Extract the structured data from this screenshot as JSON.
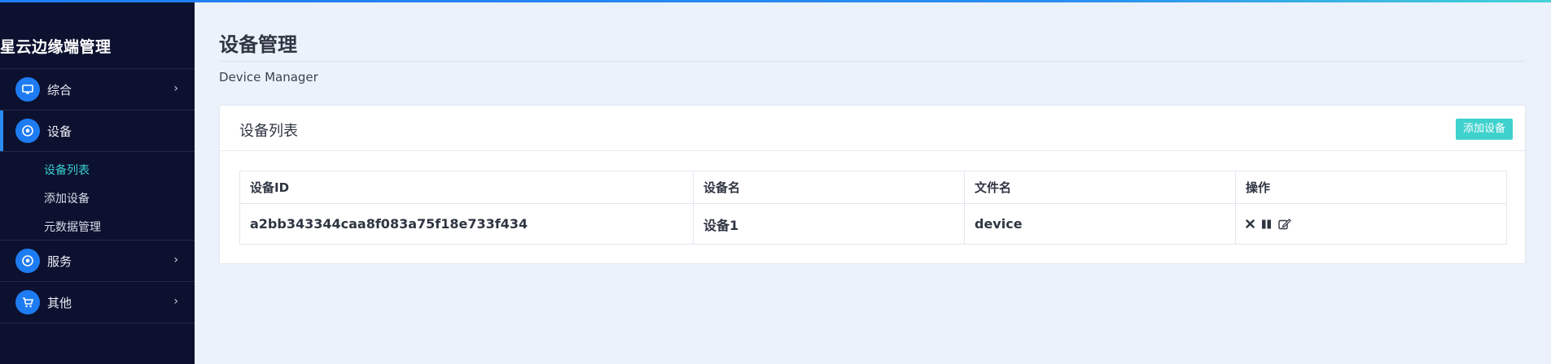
{
  "app": {
    "brand": "星云边缘端管理"
  },
  "sidebar": {
    "items": [
      {
        "label": "综合",
        "icon": "monitor-icon",
        "expanded": false
      },
      {
        "label": "设备",
        "icon": "soccer-icon",
        "expanded": true,
        "children": [
          {
            "label": "设备列表",
            "active": true
          },
          {
            "label": "添加设备",
            "active": false
          },
          {
            "label": "元数据管理",
            "active": false
          }
        ]
      },
      {
        "label": "服务",
        "icon": "soccer-icon",
        "expanded": false
      },
      {
        "label": "其他",
        "icon": "cart-icon",
        "expanded": false
      }
    ]
  },
  "page": {
    "title": "设备管理",
    "subtitle": "Device Manager"
  },
  "card": {
    "title": "设备列表",
    "add_button": "添加设备"
  },
  "table": {
    "headers": [
      "设备ID",
      "设备名",
      "文件名",
      "操作"
    ],
    "rows": [
      {
        "id": "a2bb343344caa8f083a75f18e733f434",
        "name": "设备1",
        "file": "device"
      }
    ]
  },
  "colors": {
    "sidebar_bg": "#0d1130",
    "accent": "#1e7cf2",
    "teal": "#3fd2cd",
    "page_bg": "#ecf2fb"
  }
}
